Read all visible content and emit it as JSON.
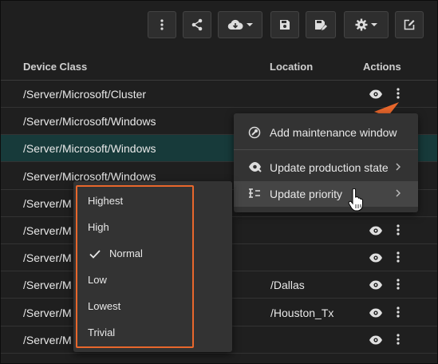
{
  "toolbar": {
    "buttons": [
      {
        "name": "more-actions",
        "icon": "kebab-vertical-icon"
      },
      {
        "name": "share",
        "icon": "share-icon"
      },
      {
        "name": "cloud-download",
        "icon": "cloud-download-icon",
        "has_dropdown": true
      },
      {
        "name": "save",
        "icon": "floppy-disk-icon"
      },
      {
        "name": "save-edit",
        "icon": "floppy-edit-icon"
      },
      {
        "name": "settings",
        "icon": "gear-icon",
        "has_dropdown": true
      },
      {
        "name": "edit",
        "icon": "edit-square-icon"
      }
    ]
  },
  "table": {
    "columns": {
      "device_class": "Device Class",
      "location": "Location",
      "actions": "Actions"
    },
    "rows": [
      {
        "device_class": "/Server/Microsoft/Cluster",
        "location": "",
        "selected": false
      },
      {
        "device_class": "/Server/Microsoft/Windows",
        "location": "",
        "selected": false
      },
      {
        "device_class": "/Server/Microsoft/Windows",
        "location": "",
        "selected": true
      },
      {
        "device_class": "/Server/Microsoft/Windows",
        "location": "",
        "selected": false
      },
      {
        "device_class": "/Server/M",
        "location": "",
        "selected": false
      },
      {
        "device_class": "/Server/M",
        "location": "",
        "selected": false
      },
      {
        "device_class": "/Server/M",
        "location": "",
        "selected": false
      },
      {
        "device_class": "/Server/M",
        "location": "/Dallas",
        "selected": false
      },
      {
        "device_class": "/Server/M",
        "location": "/Houston_Tx",
        "selected": false
      },
      {
        "device_class": "/Server/M",
        "location": "",
        "selected": false
      }
    ]
  },
  "context_menu": {
    "items": [
      {
        "label": "Add maintenance window",
        "icon": "maintenance-icon",
        "has_submenu": false
      },
      {
        "label": "Update production state",
        "icon": "production-state-icon",
        "has_submenu": true
      },
      {
        "label": "Update priority",
        "icon": "priority-icon",
        "has_submenu": true,
        "active": true
      }
    ]
  },
  "priority_submenu": {
    "items": [
      {
        "label": "Highest",
        "checked": false
      },
      {
        "label": "High",
        "checked": false
      },
      {
        "label": "Normal",
        "checked": true
      },
      {
        "label": "Low",
        "checked": false
      },
      {
        "label": "Lowest",
        "checked": false
      },
      {
        "label": "Trivial",
        "checked": false
      }
    ]
  },
  "colors": {
    "accent_orange": "#e8672c",
    "selected_row": "#173a3a",
    "background": "#1f1f1f"
  }
}
